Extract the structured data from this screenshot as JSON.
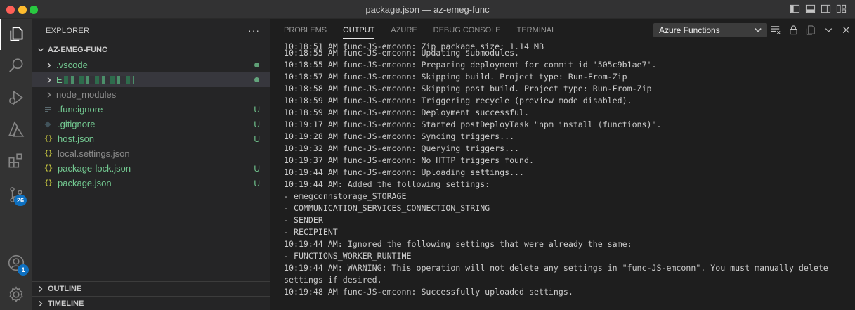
{
  "window": {
    "title": "package.json — az-emeg-func"
  },
  "activity_bar": {
    "items": [
      {
        "name": "explorer-icon",
        "active": true
      },
      {
        "name": "search-icon"
      },
      {
        "name": "run-debug-icon"
      },
      {
        "name": "azure-icon"
      },
      {
        "name": "extensions-icon"
      },
      {
        "name": "source-control-icon",
        "badge": "26"
      },
      {
        "name": "accounts-icon",
        "badge": "1"
      },
      {
        "name": "manage-gear-icon"
      }
    ]
  },
  "sidebar": {
    "header": "EXPLORER",
    "more": "···",
    "folder": "AZ-EMEG-FUNC",
    "items": [
      {
        "label": ".vscode",
        "type": "folder",
        "status": "dot",
        "color": "#73c991"
      },
      {
        "label": "E",
        "type": "folder",
        "status": "dot",
        "color": "#73c991",
        "selected": true
      },
      {
        "label": "node_modules",
        "type": "folder",
        "status": "",
        "color": "#8c8c8c"
      },
      {
        "label": ".funcignore",
        "type": "file",
        "icon": "lines-icon",
        "status": "U",
        "color": "#73c991"
      },
      {
        "label": ".gitignore",
        "type": "file",
        "icon": "git-diamond-icon",
        "status": "U",
        "color": "#73c991"
      },
      {
        "label": "host.json",
        "type": "file",
        "icon": "json-braces-icon",
        "status": "U",
        "color": "#73c991"
      },
      {
        "label": "local.settings.json",
        "type": "file",
        "icon": "json-braces-icon",
        "status": "",
        "color": "#8c8c8c"
      },
      {
        "label": "package-lock.json",
        "type": "file",
        "icon": "json-braces-icon",
        "status": "U",
        "color": "#73c991"
      },
      {
        "label": "package.json",
        "type": "file",
        "icon": "json-braces-icon",
        "status": "U",
        "color": "#73c991"
      }
    ],
    "outline": "OUTLINE",
    "timeline": "TIMELINE"
  },
  "panel": {
    "tabs": [
      "PROBLEMS",
      "OUTPUT",
      "AZURE",
      "DEBUG CONSOLE",
      "TERMINAL"
    ],
    "active_tab": "OUTPUT",
    "channel": "Azure Functions",
    "partial_line": "10:18:51 AM func-JS-emconn: Zip package size: 1.14 MB",
    "lines": [
      "10:18:55 AM func-JS-emconn: Updating submodules.",
      "10:18:55 AM func-JS-emconn: Preparing deployment for commit id '505c9b1ae7'.",
      "10:18:57 AM func-JS-emconn: Skipping build. Project type: Run-From-Zip",
      "10:18:58 AM func-JS-emconn: Skipping post build. Project type: Run-From-Zip",
      "10:18:59 AM func-JS-emconn: Triggering recycle (preview mode disabled).",
      "10:18:59 AM func-JS-emconn: Deployment successful.",
      "10:19:17 AM func-JS-emconn: Started postDeployTask \"npm install (functions)\".",
      "10:19:28 AM func-JS-emconn: Syncing triggers...",
      "10:19:32 AM func-JS-emconn: Querying triggers...",
      "10:19:37 AM func-JS-emconn: No HTTP triggers found.",
      "10:19:44 AM func-JS-emconn: Uploading settings...",
      "10:19:44 AM: Added the following settings:",
      "- emegconnstorage_STORAGE",
      "- COMMUNICATION_SERVICES_CONNECTION_STRING",
      "- SENDER",
      "- RECIPIENT",
      "10:19:44 AM: Ignored the following settings that were already the same:",
      "- FUNCTIONS_WORKER_RUNTIME",
      "10:19:44 AM: WARNING: This operation will not delete any settings in \"func-JS-emconn\". You must manually delete",
      "settings if desired.",
      "10:19:48 AM func-JS-emconn: Successfully uploaded settings."
    ]
  }
}
